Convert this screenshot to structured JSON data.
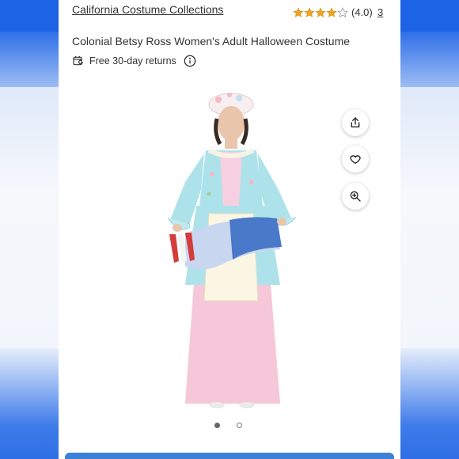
{
  "header": {
    "brand": "California Costume Collections",
    "rating_value": "(4.0)",
    "rating": 4,
    "rating_max": 5,
    "review_count": "3"
  },
  "product": {
    "title": "Colonial Betsy Ross Women's Adult Halloween Costume",
    "returns_text": "Free 30-day returns",
    "returns_icon": "calendar-return-icon",
    "image_description_icon": "product-photo"
  },
  "actions": [
    {
      "name": "share-button",
      "icon": "share-icon"
    },
    {
      "name": "favorite-button",
      "icon": "heart-icon"
    },
    {
      "name": "zoom-button",
      "icon": "zoom-in-icon"
    }
  ],
  "carousel": {
    "total": 2,
    "active_index": 0
  },
  "colors": {
    "star": "#f2a51f",
    "accent": "#3b82d6",
    "side_blue": "#1d63e6"
  }
}
